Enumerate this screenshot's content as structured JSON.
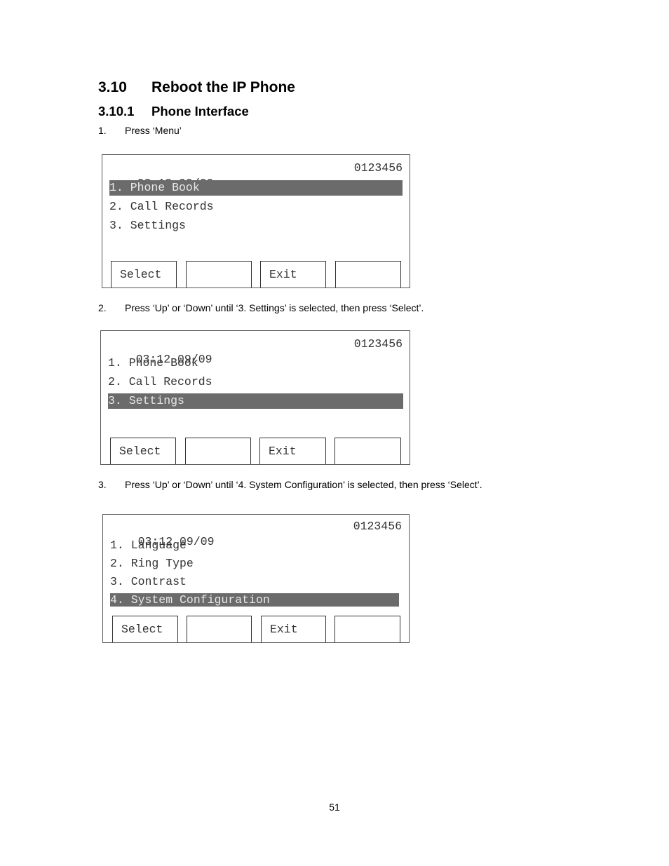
{
  "heading": {
    "number": "3.10",
    "title": "Reboot the IP Phone"
  },
  "subheading": {
    "number": "3.10.1",
    "title": "Phone Interface"
  },
  "steps": [
    {
      "number": "1.",
      "text": "Press ‘Menu’",
      "screen": {
        "time_date": "03:12 09/09",
        "extension": "0123456",
        "items": [
          "1. Phone Book",
          "2. Call Records",
          "3. Settings"
        ],
        "selected_index": 0,
        "softkeys": [
          "Select",
          "",
          "Exit",
          ""
        ]
      }
    },
    {
      "number": "2.",
      "text": "Press ‘Up’ or ‘Down’ until ‘3. Settings’ is selected, then press ‘Select’.",
      "screen": {
        "time_date": "03:12 09/09",
        "extension": "0123456",
        "items": [
          "1. Phone Book",
          "2. Call Records",
          "3. Settings"
        ],
        "selected_index": 2,
        "softkeys": [
          "Select",
          "",
          "Exit",
          ""
        ]
      }
    },
    {
      "number": "3.",
      "text": "Press ‘Up’ or ‘Down’ until ‘4. System Configuration’ is selected, then press ‘Select’.",
      "screen": {
        "time_date": "03:12 09/09",
        "extension": "0123456",
        "items": [
          "1. Language",
          "2. Ring Type",
          "3. Contrast",
          "4. System Configuration"
        ],
        "selected_index": 3,
        "softkeys": [
          "Select",
          "",
          "Exit",
          ""
        ]
      }
    }
  ],
  "page_number": "51"
}
